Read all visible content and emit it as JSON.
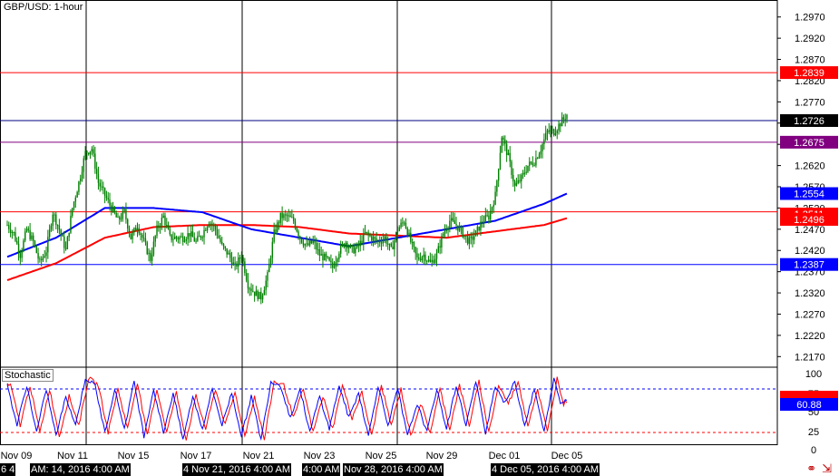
{
  "chart_title": "GBP/USD: 1-hour",
  "stochastic_label": "Stochastic",
  "colors": {
    "candle": "#008000",
    "sma_fast": "#0000ff",
    "sma_slow": "#ff0000",
    "h_red": "#ff0000",
    "h_blue": "#0000ff",
    "h_purple": "#800080",
    "stoch_k": "#0000ff",
    "stoch_d": "#ff0000",
    "badge_black": "#000000"
  },
  "bottom_timestamps": [
    "6 4",
    "AM: 14, 2016 4:00 AM",
    "4 Nov 21, 2016 4:00 AM",
    "4:00 AM",
    "Nov 28, 2016 4:00 AM",
    "4 Dec 05, 2016 4:00 AM"
  ],
  "nav_icons": [
    "link-icon",
    "arrow-right-icon"
  ],
  "chart_data": {
    "type": "candlestick",
    "title": "GBP/USD: 1-hour",
    "x_tick_labels": [
      "Nov 09",
      "Nov 11",
      "Nov 15",
      "Nov 17",
      "Nov 21",
      "Nov 23",
      "Nov 25",
      "Nov 29",
      "Dec 01",
      "Dec 05"
    ],
    "y_tick_labels": [
      "1.2970",
      "1.2920",
      "1.2870",
      "1.2820",
      "1.2770",
      "1.2720",
      "1.2670",
      "1.2620",
      "1.2570",
      "1.2520",
      "1.2470",
      "1.2420",
      "1.2370",
      "1.2320",
      "1.2270",
      "1.2220",
      "1.2170"
    ],
    "ylim": [
      1.2145,
      1.301
    ],
    "price_anchors": [
      [
        0,
        1.248
      ],
      [
        4,
        1.246
      ],
      [
        8,
        1.241
      ],
      [
        12,
        1.247
      ],
      [
        16,
        1.244
      ],
      [
        20,
        1.239
      ],
      [
        24,
        1.242
      ],
      [
        28,
        1.251
      ],
      [
        32,
        1.247
      ],
      [
        36,
        1.242
      ],
      [
        40,
        1.252
      ],
      [
        44,
        1.258
      ],
      [
        48,
        1.265
      ],
      [
        52,
        1.266
      ],
      [
        56,
        1.258
      ],
      [
        60,
        1.255
      ],
      [
        64,
        1.252
      ],
      [
        68,
        1.249
      ],
      [
        72,
        1.251
      ],
      [
        76,
        1.245
      ],
      [
        80,
        1.248
      ],
      [
        84,
        1.244
      ],
      [
        88,
        1.24
      ],
      [
        92,
        1.247
      ],
      [
        96,
        1.25
      ],
      [
        100,
        1.245
      ],
      [
        104,
        1.245
      ],
      [
        108,
        1.245
      ],
      [
        112,
        1.246
      ],
      [
        116,
        1.244
      ],
      [
        120,
        1.246
      ],
      [
        124,
        1.249
      ],
      [
        128,
        1.247
      ],
      [
        132,
        1.243
      ],
      [
        136,
        1.241
      ],
      [
        140,
        1.238
      ],
      [
        144,
        1.241
      ],
      [
        148,
        1.234
      ],
      [
        152,
        1.232
      ],
      [
        156,
        1.231
      ],
      [
        160,
        1.236
      ],
      [
        164,
        1.246
      ],
      [
        168,
        1.25
      ],
      [
        172,
        1.25
      ],
      [
        176,
        1.249
      ],
      [
        180,
        1.245
      ],
      [
        184,
        1.243
      ],
      [
        188,
        1.244
      ],
      [
        192,
        1.241
      ],
      [
        196,
        1.24
      ],
      [
        200,
        1.238
      ],
      [
        204,
        1.242
      ],
      [
        208,
        1.244
      ],
      [
        212,
        1.242
      ],
      [
        216,
        1.243
      ],
      [
        220,
        1.246
      ],
      [
        224,
        1.245
      ],
      [
        228,
        1.244
      ],
      [
        232,
        1.245
      ],
      [
        236,
        1.242
      ],
      [
        240,
        1.247
      ],
      [
        244,
        1.249
      ],
      [
        248,
        1.244
      ],
      [
        252,
        1.24
      ],
      [
        256,
        1.241
      ],
      [
        260,
        1.239
      ],
      [
        264,
        1.241
      ],
      [
        268,
        1.246
      ],
      [
        272,
        1.249
      ],
      [
        276,
        1.248
      ],
      [
        280,
        1.246
      ],
      [
        284,
        1.244
      ],
      [
        288,
        1.246
      ],
      [
        292,
        1.249
      ],
      [
        296,
        1.25
      ],
      [
        300,
        1.255
      ],
      [
        304,
        1.269
      ],
      [
        308,
        1.264
      ],
      [
        312,
        1.257
      ],
      [
        316,
        1.259
      ],
      [
        320,
        1.262
      ],
      [
        324,
        1.263
      ],
      [
        328,
        1.266
      ],
      [
        332,
        1.27
      ],
      [
        336,
        1.27
      ],
      [
        340,
        1.272
      ],
      [
        344,
        1.274
      ]
    ],
    "sma_fast": [
      [
        0,
        1.2405
      ],
      [
        30,
        1.245
      ],
      [
        60,
        1.252
      ],
      [
        90,
        1.252
      ],
      [
        120,
        1.251
      ],
      [
        150,
        1.247
      ],
      [
        180,
        1.245
      ],
      [
        210,
        1.243
      ],
      [
        240,
        1.245
      ],
      [
        270,
        1.247
      ],
      [
        300,
        1.249
      ],
      [
        330,
        1.253
      ],
      [
        344,
        1.2554
      ]
    ],
    "sma_slow": [
      [
        0,
        1.235
      ],
      [
        30,
        1.239
      ],
      [
        60,
        1.245
      ],
      [
        90,
        1.2475
      ],
      [
        120,
        1.248
      ],
      [
        150,
        1.248
      ],
      [
        180,
        1.2475
      ],
      [
        210,
        1.246
      ],
      [
        240,
        1.2455
      ],
      [
        270,
        1.245
      ],
      [
        300,
        1.2465
      ],
      [
        330,
        1.248
      ],
      [
        344,
        1.2496
      ]
    ],
    "horizontal_lines": [
      {
        "price": 1.2839,
        "label": "1.2839",
        "color": "#ff0000",
        "badge_bg": "#ff0000"
      },
      {
        "price": 1.2726,
        "label": "1.2726",
        "color": "#000080",
        "badge_bg": "#000000"
      },
      {
        "price": 1.2675,
        "label": "1.2675",
        "color": "#800080",
        "badge_bg": "#800080"
      },
      {
        "price": 1.2554,
        "label": "1.2554",
        "color": "#0000ff",
        "badge_bg": "#0000ff",
        "no_line": true
      },
      {
        "price": 1.2511,
        "label": "1.2511",
        "color": "#ff0000",
        "badge_bg": "#ff0000"
      },
      {
        "price": 1.2496,
        "label": "1.2496",
        "color": "#ff0000",
        "badge_bg": "#ff0000",
        "no_line": true
      },
      {
        "price": 1.2387,
        "label": "1.2387",
        "color": "#0000ff",
        "badge_bg": "#0000ff"
      }
    ],
    "stochastic": {
      "ylim": [
        0,
        100
      ],
      "y_tick_labels": [
        "100",
        "75",
        "50",
        "25",
        "0"
      ],
      "levels": [
        80,
        20
      ],
      "current_value": "60.88",
      "k_anchors": [
        [
          0,
          85
        ],
        [
          6,
          30
        ],
        [
          12,
          85
        ],
        [
          18,
          20
        ],
        [
          24,
          80
        ],
        [
          30,
          15
        ],
        [
          36,
          70
        ],
        [
          42,
          30
        ],
        [
          48,
          95
        ],
        [
          54,
          85
        ],
        [
          60,
          20
        ],
        [
          66,
          80
        ],
        [
          72,
          25
        ],
        [
          78,
          90
        ],
        [
          84,
          15
        ],
        [
          90,
          80
        ],
        [
          96,
          20
        ],
        [
          102,
          75
        ],
        [
          108,
          10
        ],
        [
          114,
          70
        ],
        [
          120,
          25
        ],
        [
          126,
          80
        ],
        [
          132,
          30
        ],
        [
          138,
          75
        ],
        [
          144,
          15
        ],
        [
          150,
          70
        ],
        [
          156,
          10
        ],
        [
          162,
          90
        ],
        [
          168,
          85
        ],
        [
          174,
          40
        ],
        [
          180,
          80
        ],
        [
          186,
          20
        ],
        [
          192,
          70
        ],
        [
          198,
          25
        ],
        [
          204,
          85
        ],
        [
          210,
          40
        ],
        [
          216,
          75
        ],
        [
          222,
          15
        ],
        [
          228,
          85
        ],
        [
          234,
          30
        ],
        [
          240,
          80
        ],
        [
          246,
          15
        ],
        [
          252,
          60
        ],
        [
          258,
          20
        ],
        [
          264,
          80
        ],
        [
          270,
          25
        ],
        [
          276,
          85
        ],
        [
          282,
          30
        ],
        [
          288,
          90
        ],
        [
          294,
          20
        ],
        [
          300,
          85
        ],
        [
          306,
          60
        ],
        [
          312,
          90
        ],
        [
          318,
          30
        ],
        [
          324,
          80
        ],
        [
          330,
          20
        ],
        [
          336,
          95
        ],
        [
          340,
          60
        ],
        [
          344,
          65
        ]
      ]
    }
  }
}
